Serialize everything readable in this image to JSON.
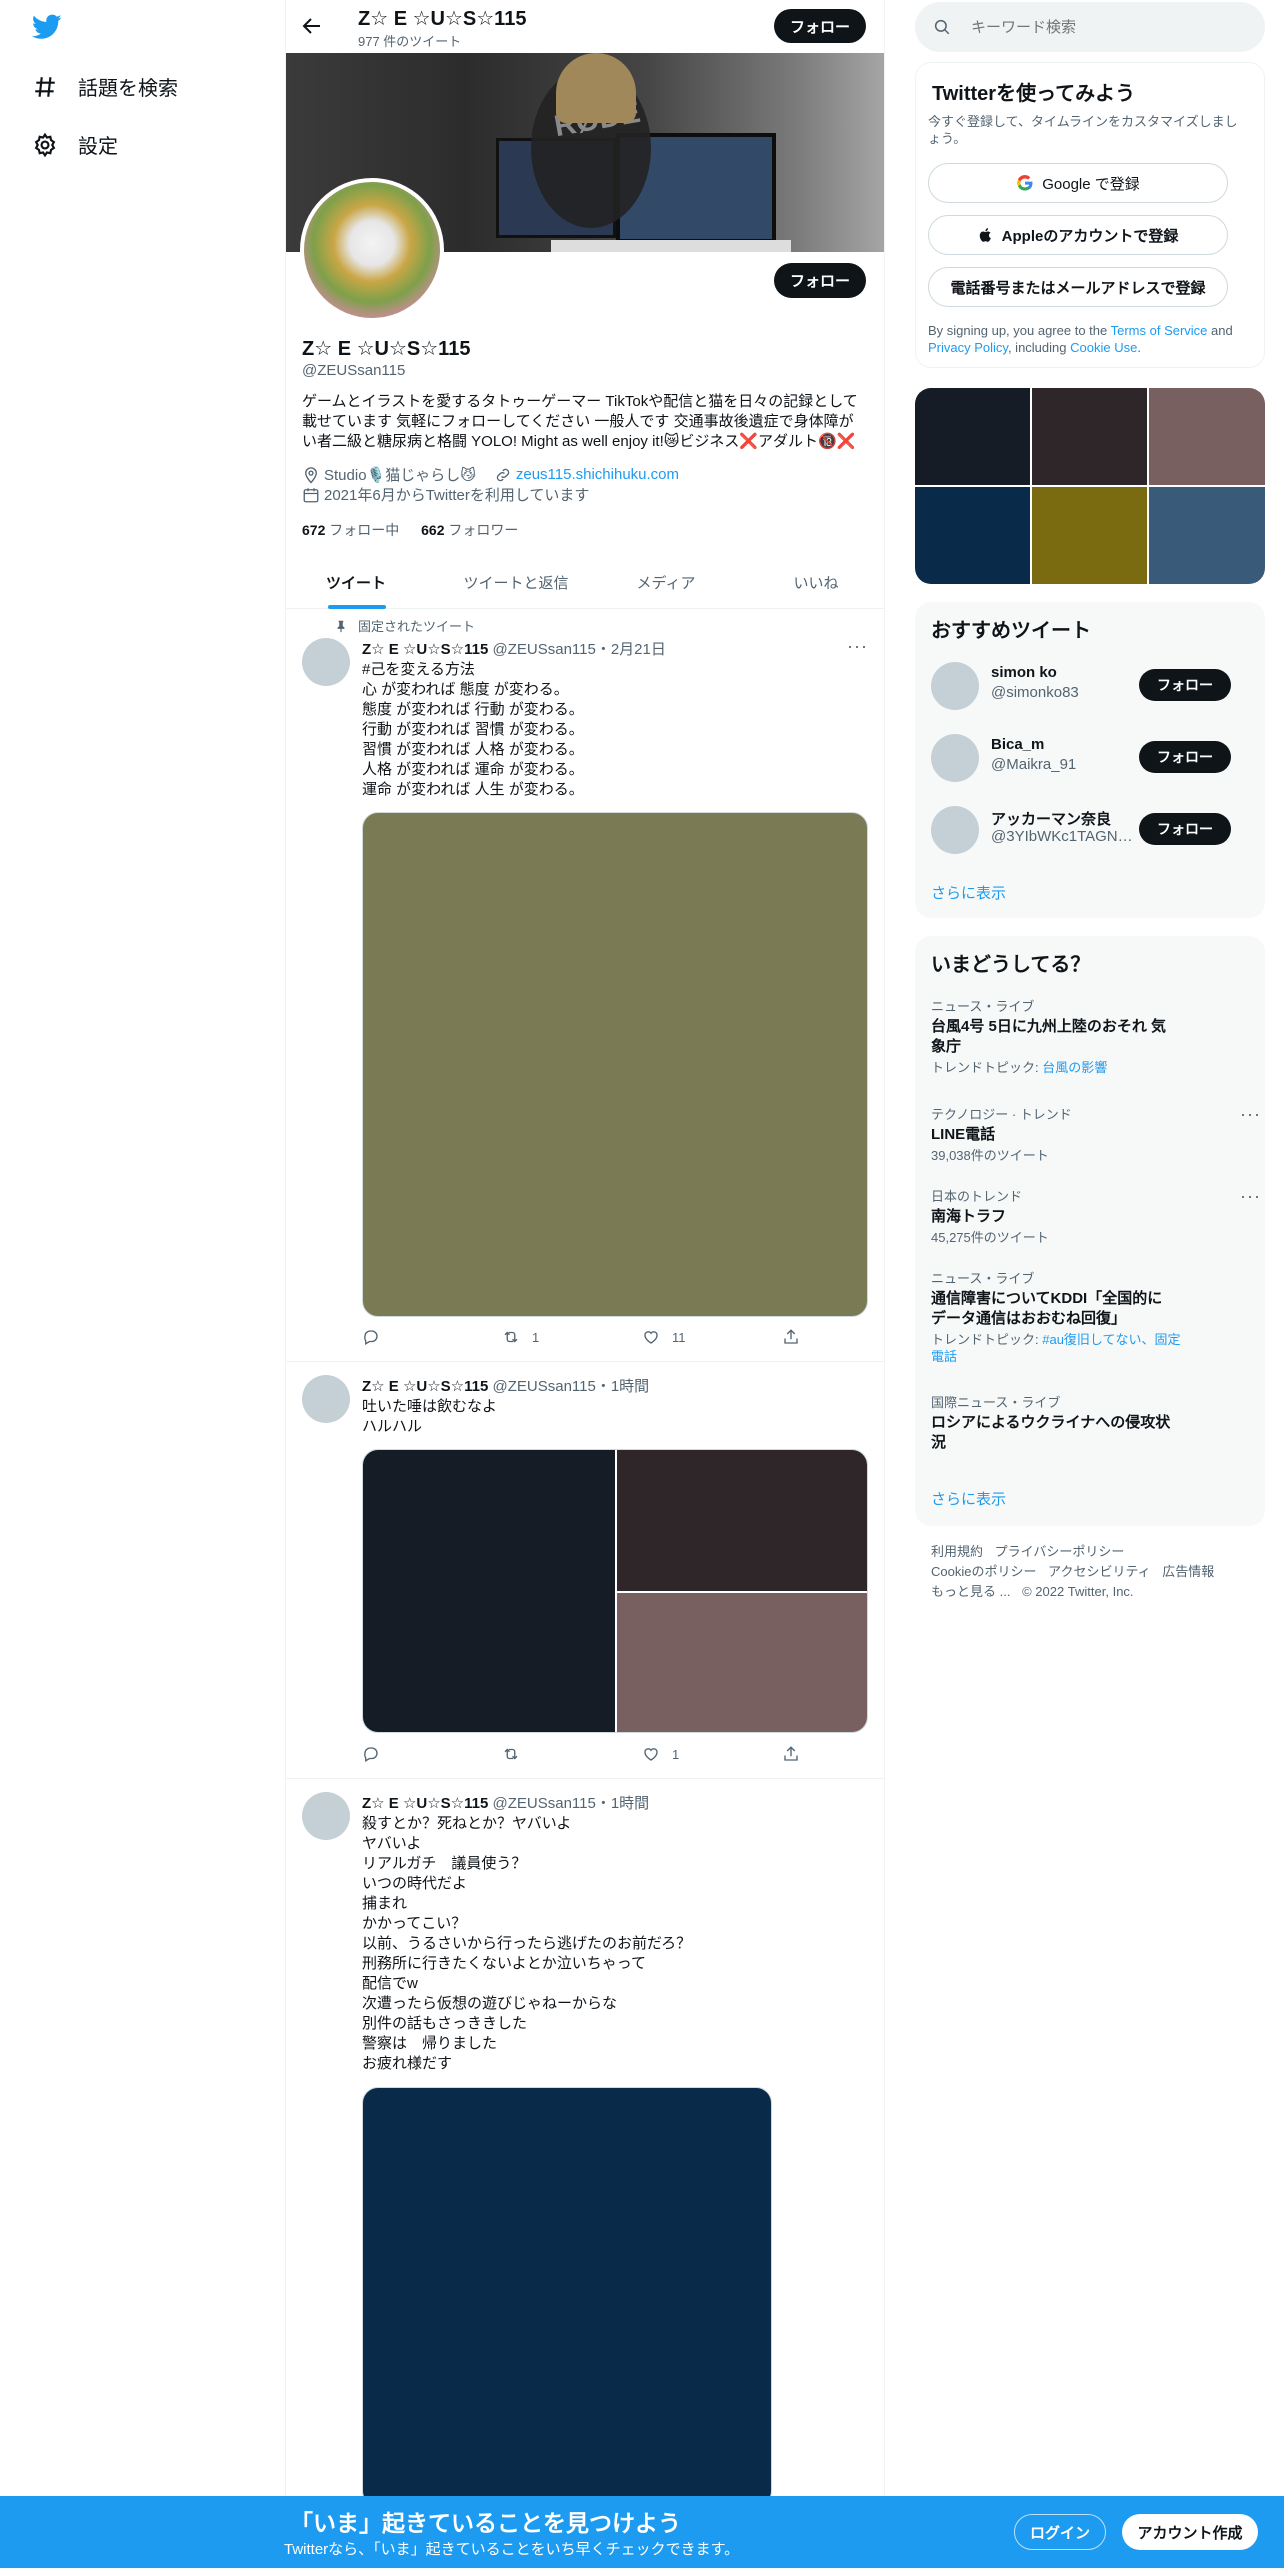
{
  "nav": {
    "explore_label": "話題を検索",
    "settings_label": "設定"
  },
  "header": {
    "name": "Z☆ E ☆U☆S☆115",
    "tweet_count": "977 件のツイート",
    "follow_label": "フォロー"
  },
  "profile": {
    "name": "Z☆ E ☆U☆S☆115",
    "handle": "@ZEUSsan115",
    "bio_line1": "ゲームとイラストを愛するタトゥーゲーマー TikTokや配信と猫を日々の記録として",
    "bio_line2": "載せています 気軽にフォローしてください 一般人です 交通事故後遺症で身体障が",
    "bio_line3": "い者二級と糖尿病と格闘 YOLO! Might as well enjoy it!😿ビジネス❌アダルト🔞❌",
    "location": "Studio🎙️猫じゃらし😼",
    "website": "zeus115.shichihuku.com",
    "joined": "2021年6月からTwitterを利用しています",
    "following_count": "672",
    "following_label": "フォロー中",
    "followers_count": "662",
    "followers_label": "フォロワー",
    "follow_label": "フォロー"
  },
  "tabs": [
    "ツイート",
    "ツイートと返信",
    "メディア",
    "いいね"
  ],
  "tweets": [
    {
      "pinned_label": "固定されたツイート",
      "name": "Z☆ E ☆U☆S☆115",
      "handle": "@ZEUSsan115",
      "time": "・2月21日",
      "hashtag": "#己を変える方法",
      "text": "心 が変われば 態度 が変わる。\n態度 が変われば 行動 が変わる。\n行動 が変われば 習慣 が変わる。\n習慣 が変われば 人格 が変わる。\n人格 が変われば 運命 が変わる。\n運命 が変われば 人生 が変わる。",
      "retweets": "1",
      "likes": "11",
      "media_colors": [
        "#7a7a55"
      ]
    },
    {
      "name": "Z☆ E ☆U☆S☆115",
      "handle": "@ZEUSsan115",
      "time": "・1時間",
      "text": "吐いた唾は飲むなよ\nハルハル",
      "retweets": "",
      "likes": "1",
      "media_colors": [
        "#161c25",
        "#2e2628",
        "#785f60"
      ]
    },
    {
      "name": "Z☆ E ☆U☆S☆115",
      "handle": "@ZEUSsan115",
      "time": "・1時間",
      "text": "殺すとか？死ねとか？ヤバいよ\nヤバいよ\nリアルガチ　議員使う？\nいつの時代だよ\n捕まれ\nかかってこい？\n以前、うるさいから行ったら逃げたのお前だろ？\n刑務所に行きたくないよとか泣いちゃって\n配信でw\n次遭ったら仮想の遊びじゃねーからな\n別件の話もさっききした\n警察は　帰りました\nお疲れ様だす",
      "media_colors": [
        "#0a2a4a"
      ]
    }
  ],
  "search": {
    "placeholder": "キーワード検索"
  },
  "signup": {
    "title": "Twitterを使ってみよう",
    "subtitle": "今すぐ登録して、タイムラインをカスタマイズしましょう。",
    "google_label": "Google で登録",
    "apple_label": "Appleのアカウントで登録",
    "phone_label": "電話番号またはメールアドレスで登録",
    "legal_prefix": "By signing up, you agree to the ",
    "terms": "Terms of Service",
    "and": " and ",
    "privacy": "Privacy Policy",
    "including": ", including ",
    "cookie": "Cookie Use",
    "period": "."
  },
  "media_grid": {
    "colors": [
      "#161c25",
      "#2e2628",
      "#785f60",
      "#0a2a4a",
      "#7a6a10",
      "#3a5a7a"
    ]
  },
  "recommended": {
    "title": "おすすめツイート",
    "users": [
      {
        "name": "simon ko",
        "handle": "@simonko83",
        "follow": "フォロー"
      },
      {
        "name": "Bica_m",
        "handle": "@Maikra_91",
        "follow": "フォロー"
      },
      {
        "name": "アッカーマン奈良",
        "handle": "@3YIbWKc1TAGNQ...",
        "follow": "フォロー"
      }
    ],
    "show_more": "さらに表示"
  },
  "trends": {
    "title": "いまどうしてる？",
    "items": [
      {
        "category": "ニュース・ライブ",
        "title": "台風4号 5日に九州上陸のおそれ 気象庁",
        "sub_prefix": "トレンドトピック: ",
        "sub_link": "台風の影響"
      },
      {
        "category": "テクノロジー · トレンド",
        "title": "LINE電話",
        "count": "39,038件のツイート"
      },
      {
        "category": "日本のトレンド",
        "title": "南海トラフ",
        "count": "45,275件のツイート"
      },
      {
        "category": "ニュース・ライブ",
        "title": "通信障害についてKDDI「全国的にデータ通信はおおむね回復」",
        "sub_prefix": "トレンドトピック: ",
        "sub_link": "#au復旧してない、固定電話"
      },
      {
        "category": "国際ニュース・ライブ",
        "title": "ロシアによるウクライナへの侵攻状況"
      }
    ],
    "show_more": "さらに表示"
  },
  "footer": {
    "terms": "利用規約",
    "privacy": "プライバシーポリシー",
    "cookie": "Cookieのポリシー",
    "accessibility": "アクセシビリティ",
    "ads": "広告情報",
    "more": "もっと見る ...",
    "copyright": "© 2022 Twitter, Inc."
  },
  "banner": {
    "title": "「いま」起きていることを見つけよう",
    "subtitle": "Twitterなら、「いま」起きていることをいち早くチェックできます。",
    "login": "ログイン",
    "signup": "アカウント作成"
  },
  "colors": {
    "accent": "#1d9bf0",
    "dark": "#0f1419",
    "muted": "#536471"
  }
}
